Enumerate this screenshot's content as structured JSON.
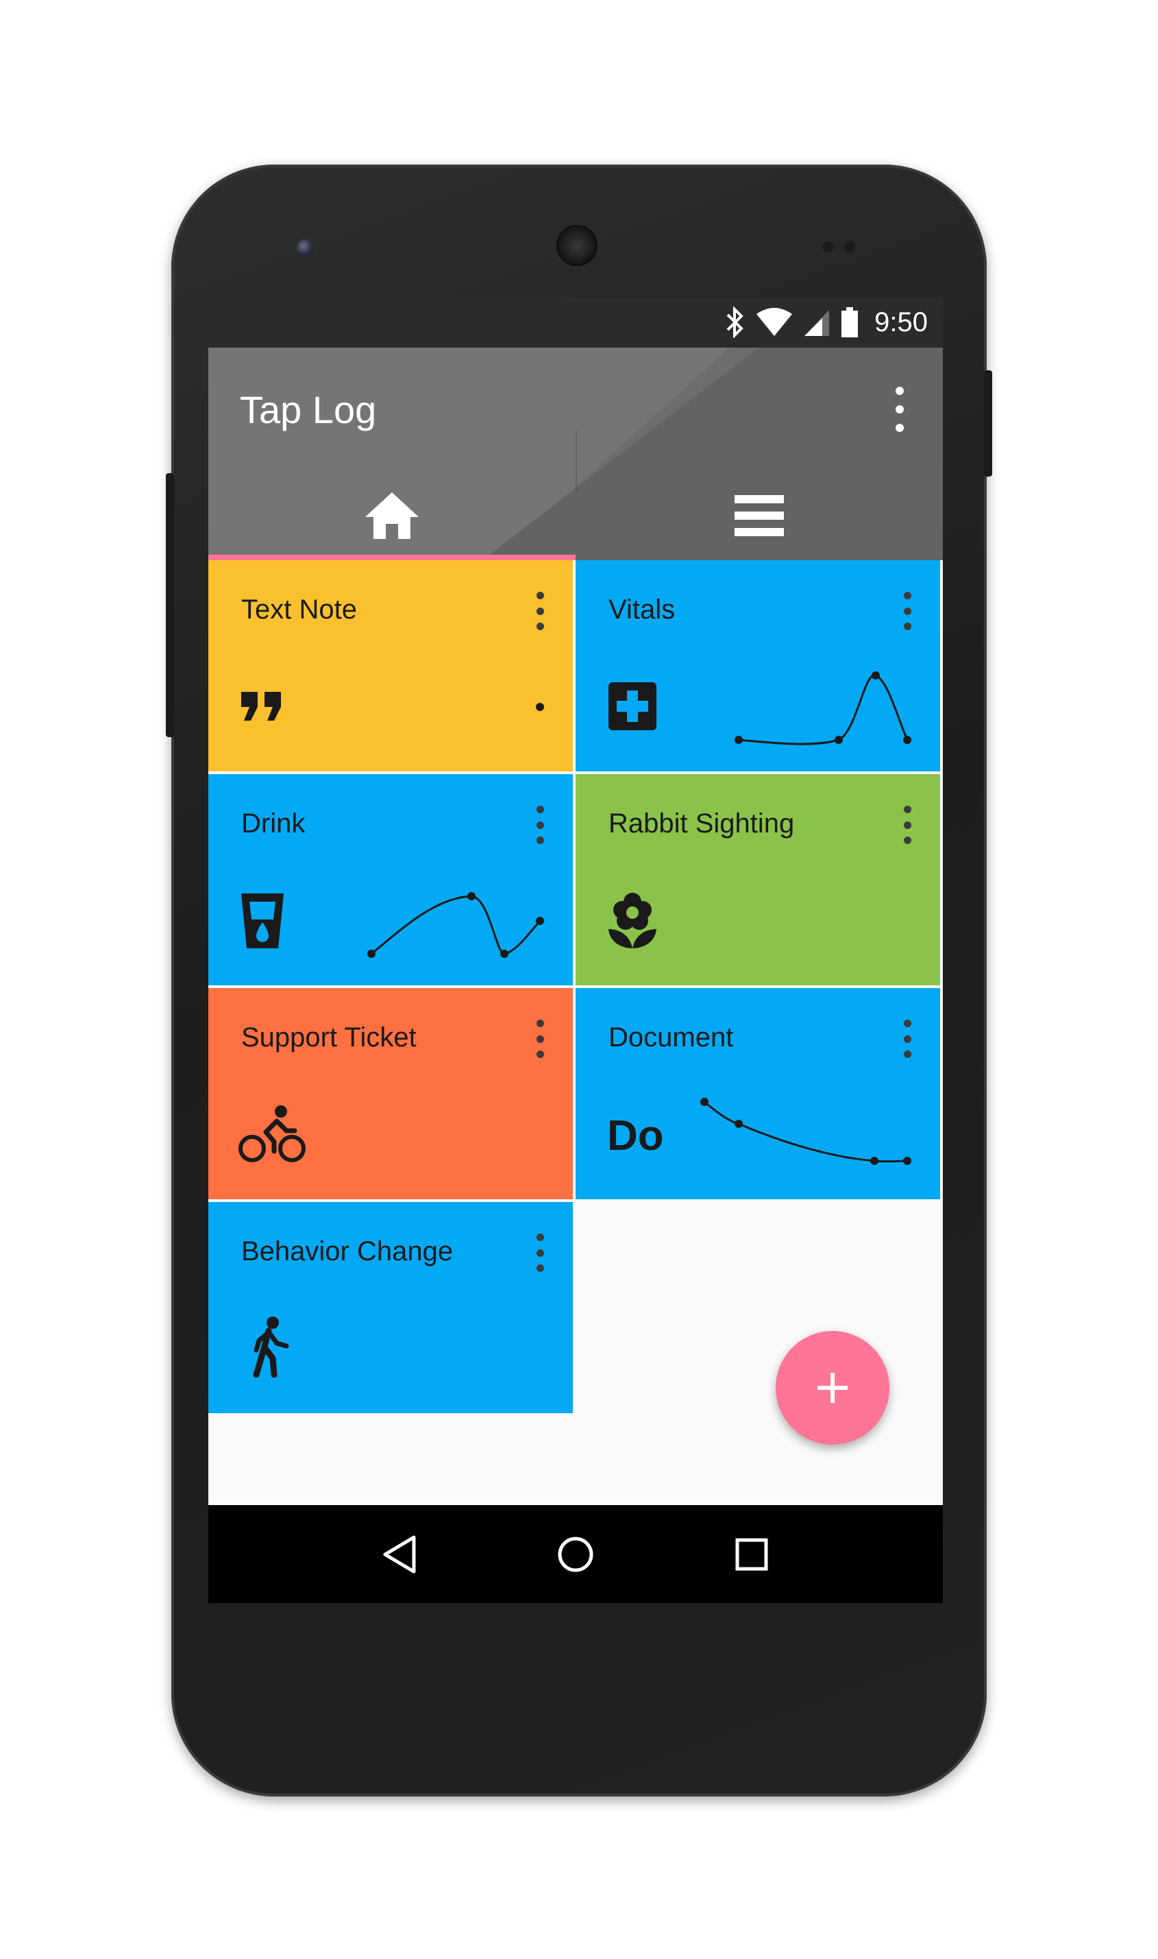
{
  "app": {
    "title": "Tap Log",
    "accent_color": "#ff7597",
    "appbar_color": "#6d6d6d",
    "statusbar_color": "#2b2b2b",
    "overflow_icon": "more-vert-icon"
  },
  "status_bar": {
    "time": "9:50",
    "icons": [
      "bluetooth-icon",
      "wifi-icon",
      "cell-signal-icon",
      "battery-icon"
    ]
  },
  "tabs": [
    {
      "icon": "home-icon",
      "selected": true
    },
    {
      "icon": "list-icon",
      "selected": false
    }
  ],
  "tiles": [
    {
      "title": "Text Note",
      "color": "#fbc02d",
      "icon": "format-quote-icon",
      "has_sparkline": false
    },
    {
      "title": "Vitals",
      "color": "#03a9f4",
      "icon": "medical-cross-icon",
      "has_sparkline": true
    },
    {
      "title": "Drink",
      "color": "#03a9f4",
      "icon": "cup-water-icon",
      "has_sparkline": true
    },
    {
      "title": "Rabbit Sighting",
      "color": "#8bc34a",
      "icon": "flower-icon",
      "has_sparkline": false
    },
    {
      "title": "Support Ticket",
      "color": "#ff7043",
      "icon": "bike-icon",
      "has_sparkline": false
    },
    {
      "title": "Document",
      "color": "#03a9f4",
      "icon_text": "Do",
      "has_sparkline": true
    },
    {
      "title": "Behavior Change",
      "color": "#03a9f4",
      "icon": "walking-person-icon",
      "has_sparkline": false
    }
  ],
  "fab": {
    "icon": "plus-icon"
  },
  "nav_bar": {
    "icons": [
      "back-icon",
      "home-circle-icon",
      "recents-icon"
    ]
  }
}
